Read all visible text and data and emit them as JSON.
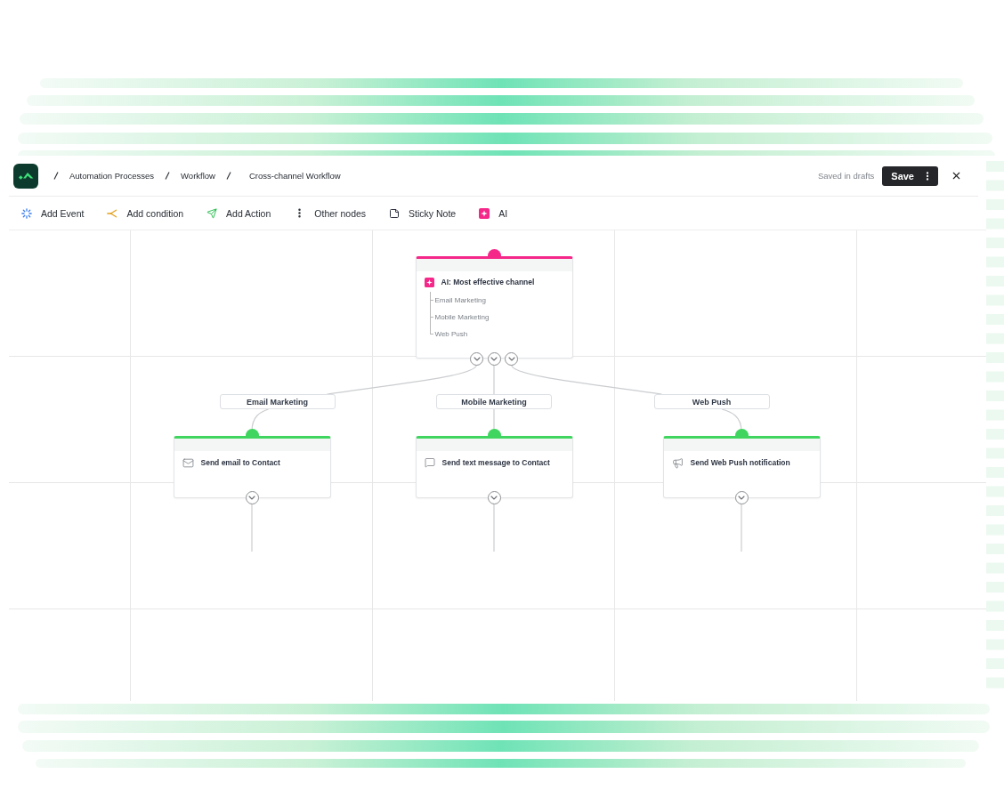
{
  "header": {
    "breadcrumbs": [
      "Automation Processes",
      "Workflow",
      "Cross-channel Workflow"
    ],
    "status": "Saved in drafts",
    "save_label": "Save"
  },
  "toolbar": [
    {
      "label": "Add Event",
      "kind": "event"
    },
    {
      "label": "Add condition",
      "kind": "condition"
    },
    {
      "label": "Add Action",
      "kind": "action"
    },
    {
      "label": "Other nodes",
      "kind": "more"
    },
    {
      "label": "Sticky Note",
      "kind": "note"
    },
    {
      "label": "AI",
      "kind": "ai"
    }
  ],
  "canvas": {
    "decision_node": {
      "title": "AI: Most effective channel",
      "options": [
        "Email Marketing",
        "Mobile Marketing",
        "Web Push"
      ]
    },
    "branches": [
      {
        "label": "Email Marketing",
        "action": "Send email to Contact",
        "kind": "email"
      },
      {
        "label": "Mobile Marketing",
        "action": "Send text message to Contact",
        "kind": "sms"
      },
      {
        "label": "Web Push",
        "action": "Send Web Push notification",
        "kind": "web_push"
      }
    ]
  }
}
